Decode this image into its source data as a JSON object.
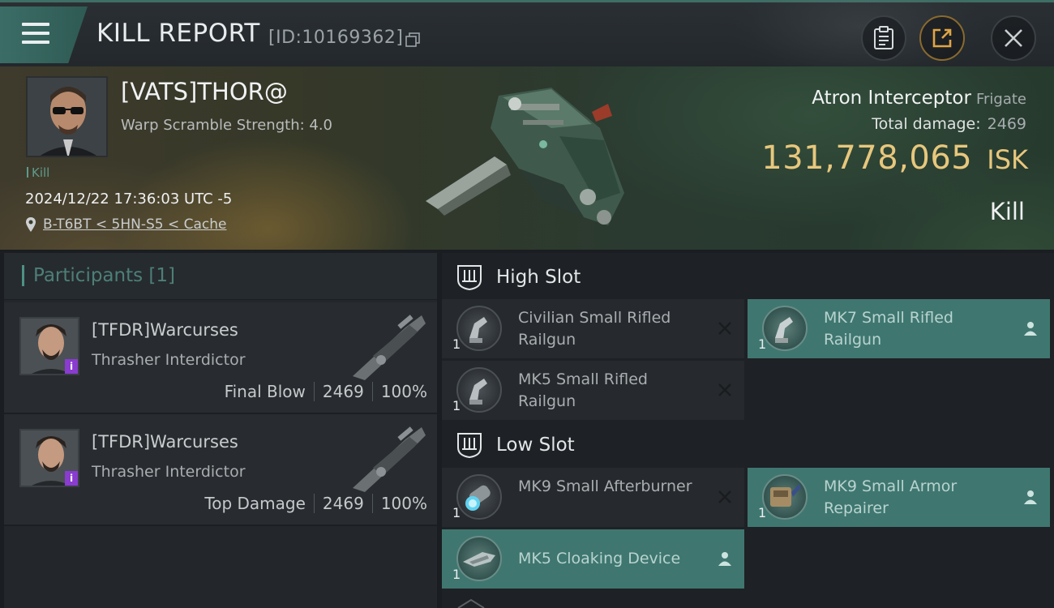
{
  "header": {
    "title": "KILL REPORT",
    "report_id": "[ID:10169362]"
  },
  "hero": {
    "pilot_name": "[VATS]THOR@",
    "warp_scramble": "Warp Scramble Strength: 4.0",
    "kill_tag": "Kill",
    "timestamp": "2024/12/22 17:36:03 UTC -5",
    "location": "B-T6BT < 5HN-S5 < Cache",
    "ship_name": "Atron Interceptor",
    "ship_class": "Frigate",
    "total_damage_label": "Total damage:",
    "total_damage_value": "2469",
    "isk_value": "131,778,065",
    "isk_unit": "ISK",
    "result": "Kill"
  },
  "participants": {
    "title": "Participants [1]",
    "rows": [
      {
        "name": "[TFDR]Warcurses",
        "ship": "Thrasher Interdictor",
        "role": "Final Blow",
        "damage": "2469",
        "percent": "100%"
      },
      {
        "name": "[TFDR]Warcurses",
        "ship": "Thrasher Interdictor",
        "role": "Top Damage",
        "damage": "2469",
        "percent": "100%"
      }
    ]
  },
  "slots": {
    "high": {
      "title": "High Slot",
      "modules": [
        {
          "name": "Civilian Small Rifled Railgun",
          "qty": "1",
          "status": "destroyed"
        },
        {
          "name": "MK7 Small Rifled Railgun",
          "qty": "1",
          "status": "dropped"
        },
        {
          "name": "MK5 Small Rifled Railgun",
          "qty": "1",
          "status": "destroyed"
        }
      ]
    },
    "low": {
      "title": "Low Slot",
      "modules": [
        {
          "name": "MK9 Small Afterburner",
          "qty": "1",
          "status": "destroyed"
        },
        {
          "name": "MK9 Small Armor Repairer",
          "qty": "1",
          "status": "dropped"
        },
        {
          "name": "MK5 Cloaking Device",
          "qty": "1",
          "status": "dropped"
        }
      ]
    }
  },
  "colors": {
    "accent_teal": "#3f7770",
    "isk_gold": "#e7c77d",
    "badge_purple": "#8a3bd0"
  },
  "icons": [
    "menu-icon",
    "copy-icon",
    "clipboard-icon",
    "share-icon",
    "close-icon",
    "location-pin-icon",
    "slot-icon",
    "destroyed-x-icon",
    "person-icon"
  ]
}
